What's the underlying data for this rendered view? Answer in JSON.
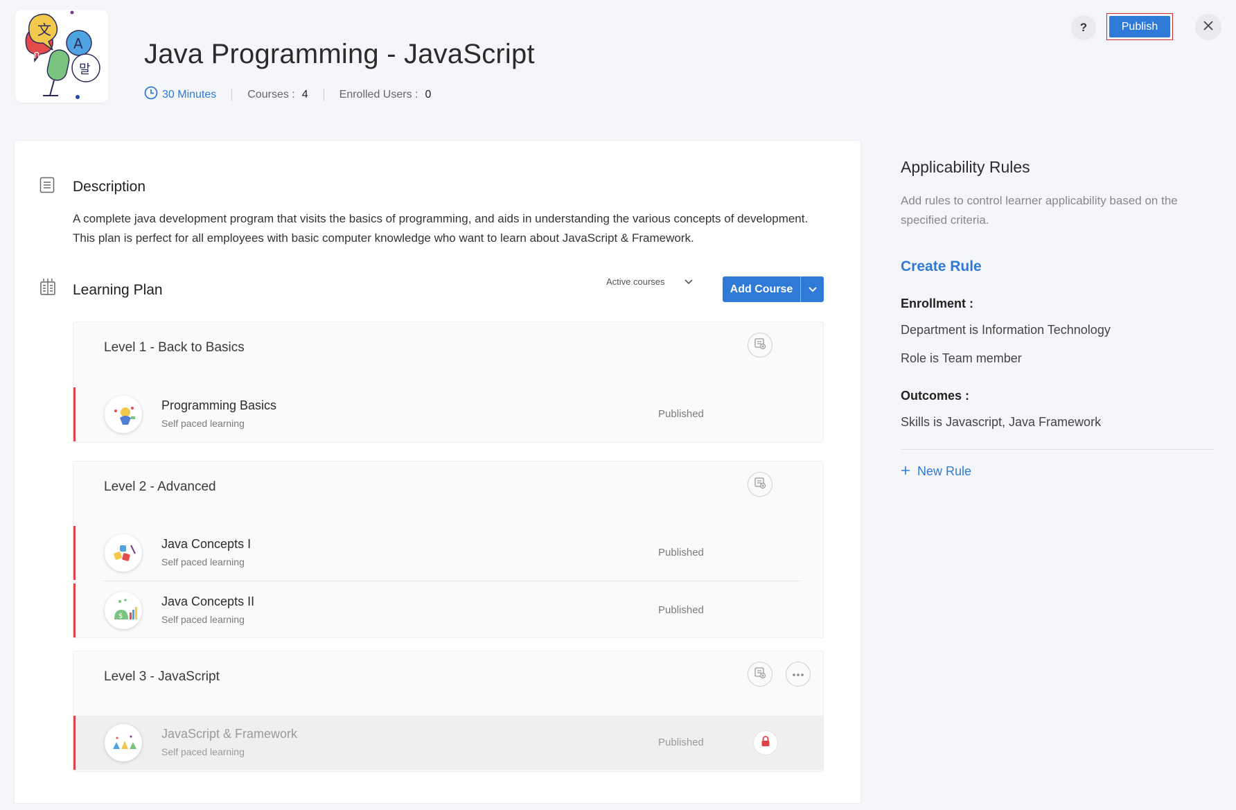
{
  "header": {
    "title": "Java Programming - JavaScript",
    "duration": "30 Minutes",
    "courses_label": "Courses :",
    "courses_count": "4",
    "enrolled_label": "Enrolled Users :",
    "enrolled_count": "0",
    "help_label": "?",
    "publish_label": "Publish"
  },
  "description": {
    "heading": "Description",
    "text": "A complete java development program that visits the basics of programming, and aids in understanding the various concepts of development. This plan is perfect for all employees with basic computer knowledge who want to learn about JavaScript & Framework."
  },
  "learning_plan": {
    "heading": "Learning Plan",
    "filter_label": "Active courses",
    "add_course_label": "Add Course",
    "levels": [
      {
        "title": "Level 1 - Back to Basics",
        "courses": [
          {
            "name": "Programming Basics",
            "type": "Self paced learning",
            "status": "Published"
          }
        ]
      },
      {
        "title": "Level 2 - Advanced",
        "courses": [
          {
            "name": "Java Concepts I",
            "type": "Self paced learning",
            "status": "Published"
          },
          {
            "name": "Java Concepts II",
            "type": "Self paced learning",
            "status": "Published"
          }
        ]
      },
      {
        "title": "Level 3 - JavaScript",
        "courses": [
          {
            "name": "JavaScript & Framework",
            "type": "Self paced learning",
            "status": "Published"
          }
        ]
      }
    ]
  },
  "rules": {
    "title": "Applicability Rules",
    "subtitle": "Add rules to control learner applicability based on the specified criteria.",
    "create_label": "Create Rule",
    "enrollment_heading": "Enrollment :",
    "enrollment_items": [
      "Department is Information Technology",
      "Role is Team member"
    ],
    "outcomes_heading": "Outcomes :",
    "outcomes_items": [
      "Skills is Javascript, Java Framework"
    ],
    "new_rule_label": "New Rule"
  },
  "colors": {
    "accent": "#2f7ad6",
    "course_marker": "#e0424a",
    "highlight_border": "#d9252e"
  }
}
